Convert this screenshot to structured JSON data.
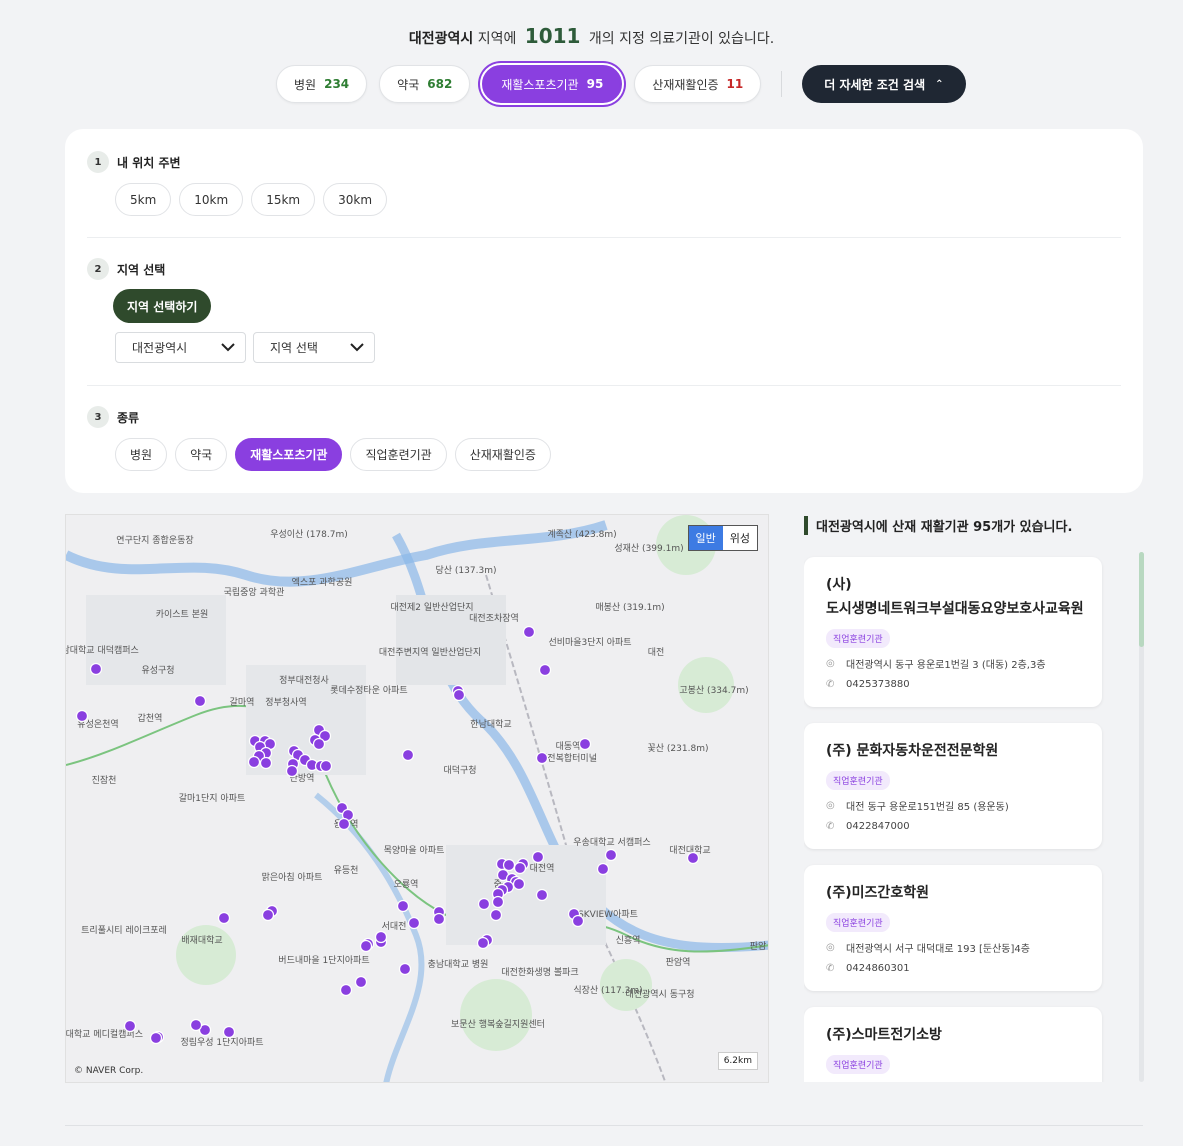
{
  "summary": {
    "region": "대전광역시",
    "pre": "지역에",
    "count": "1011",
    "post": "개의 지정 의료기관이 있습니다."
  },
  "categories": [
    {
      "label": "병원",
      "count": "234",
      "color": "#2e7d32"
    },
    {
      "label": "약국",
      "count": "682",
      "color": "#2e7d32"
    },
    {
      "label": "재활스포츠기관",
      "count": "95",
      "color": "#ffffff"
    },
    {
      "label": "산재재활인증",
      "count": "11",
      "color": "#c62828"
    }
  ],
  "detail_button": "더 자세한 조건 검색",
  "filters": {
    "step1": {
      "num": "1",
      "title": "내 위치 주변",
      "options": [
        "5km",
        "10km",
        "15km",
        "30km"
      ]
    },
    "step2": {
      "num": "2",
      "title": "지역 선택",
      "button": "지역 선택하기",
      "select_city": "대전광역시",
      "select_district": "지역 선택"
    },
    "step3": {
      "num": "3",
      "title": "종류",
      "options": [
        "병원",
        "약국",
        "재활스포츠기관",
        "직업훈련기관",
        "산재재활인증"
      ],
      "selected": "재활스포츠기관"
    }
  },
  "map": {
    "toggle": [
      "일반",
      "위성"
    ],
    "scale": "6.2km",
    "copyright": "© NAVER Corp.",
    "labels": [
      "연구단지 종합운동장",
      "우성이산 (178.7m)",
      "계족산 (423.8m)",
      "성재산 (399.1m)",
      "당산 (137.3m)",
      "엑스포 과학공원",
      "국립중앙 과학관",
      "카이스트 본원",
      "대전제2 일반산업단지",
      "대전조차장역",
      "매봉산 (319.1m)",
      "선비마을3단지 아파트",
      "충남대학교 대덕캠퍼스",
      "유성구청",
      "대전주변지역 일반산업단지",
      "정부대전청사",
      "롯데수정타운 아파트",
      "고봉산 (334.7m)",
      "갈마역",
      "정부청사역",
      "한남대학교",
      "유성온천역",
      "갑천역",
      "대동역",
      "대전복합터미널",
      "꽃산 (231.8m)",
      "진잠천",
      "갈마1단지 아파트",
      "대덕구청",
      "탄방역",
      "용문역",
      "목양마을 아파트",
      "우송대학교 서캠퍼스",
      "대전대학교",
      "맑은아침 아파트",
      "유등천",
      "오룡역",
      "대전역",
      "트리풀시티 레이크포레",
      "배재대학교",
      "서대전",
      "중구청",
      "SKVIEW아파트",
      "신흥역",
      "판암역",
      "버드내마을 1단지아파트",
      "충남대학교 병원",
      "대전한화생명 볼파크",
      "식장산 (117.3m)",
      "대전광역시 동구청",
      "건양대학교 메디컬캠퍼스",
      "정림우성 1단지아파트",
      "보문산 행복숲길지원센터",
      "대전",
      "판암"
    ],
    "marker_count": "95"
  },
  "list": {
    "title": "대전광역시에 산재 재활기관 95개가 있습니다.",
    "items": [
      {
        "name": "(사)\n도시생명네트워크부설대동요양보호사교육원",
        "tag": "직업훈련기관",
        "address": "대전광역시 동구 용운로1번길 3 (대동) 2층,3층",
        "phone": "0425373880"
      },
      {
        "name": "(주)  문화자동차운전전문학원",
        "tag": "직업훈련기관",
        "address": "대전 동구 용운로151번길 85 (용운동)",
        "phone": "0422847000"
      },
      {
        "name": "(주)미즈간호학원",
        "tag": "직업훈련기관",
        "address": "대전광역시 서구 대덕대로 193 [둔산동]4층",
        "phone": "0424860301"
      },
      {
        "name": "(주)스마트전기소방",
        "tag": "직업훈련기관",
        "address": "",
        "phone": ""
      }
    ]
  },
  "colors": {
    "accent": "#8a3fe0",
    "dark": "#1f2733",
    "green": "#2f4a2c"
  },
  "icons": {
    "location": "location-pin-icon",
    "phone": "phone-icon",
    "chevron": "chevron-up-icon"
  }
}
